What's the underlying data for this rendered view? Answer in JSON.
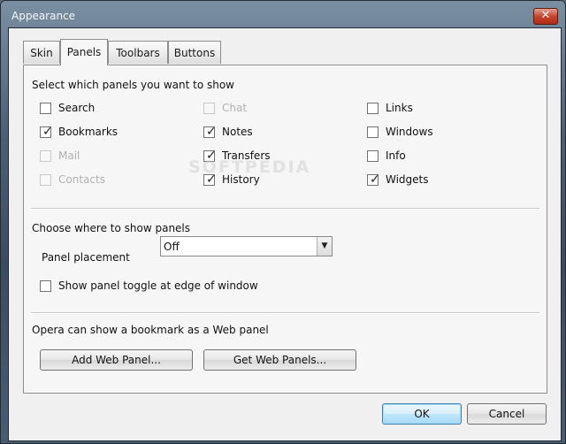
{
  "window": {
    "title": "Appearance"
  },
  "tabs": [
    {
      "label": "Skin",
      "active": false
    },
    {
      "label": "Panels",
      "active": true
    },
    {
      "label": "Toolbars",
      "active": false
    },
    {
      "label": "Buttons",
      "active": false
    }
  ],
  "panels_section": {
    "title": "Select which panels you want to show",
    "checkboxes": [
      {
        "label": "Search",
        "checked": false,
        "enabled": true
      },
      {
        "label": "Bookmarks",
        "checked": true,
        "enabled": true
      },
      {
        "label": "Mail",
        "checked": false,
        "enabled": false
      },
      {
        "label": "Contacts",
        "checked": false,
        "enabled": false
      },
      {
        "label": "Chat",
        "checked": false,
        "enabled": false
      },
      {
        "label": "Notes",
        "checked": true,
        "enabled": true
      },
      {
        "label": "Transfers",
        "checked": true,
        "enabled": true
      },
      {
        "label": "History",
        "checked": true,
        "enabled": true
      },
      {
        "label": "Links",
        "checked": false,
        "enabled": true
      },
      {
        "label": "Windows",
        "checked": false,
        "enabled": true
      },
      {
        "label": "Info",
        "checked": false,
        "enabled": true
      },
      {
        "label": "Widgets",
        "checked": true,
        "enabled": true
      }
    ]
  },
  "placement_section": {
    "title": "Choose where to show panels",
    "placement_label": "Panel placement",
    "placement_value": "Off",
    "toggle_label": "Show panel toggle at edge of window",
    "toggle_checked": false
  },
  "web_panel_section": {
    "title": "Opera can show a bookmark as a Web panel",
    "add_button": "Add Web Panel...",
    "get_button": "Get Web Panels..."
  },
  "footer": {
    "ok": "OK",
    "cancel": "Cancel"
  },
  "watermark": "SOFTPEDIA",
  "colors": {
    "title_text": "#f4f8fb",
    "close_button": "#c7432b",
    "default_button_border": "#3c7fb1"
  },
  "icons": {
    "close": "close-icon",
    "check": "checkmark-icon",
    "dropdown": "chevron-down-icon"
  }
}
